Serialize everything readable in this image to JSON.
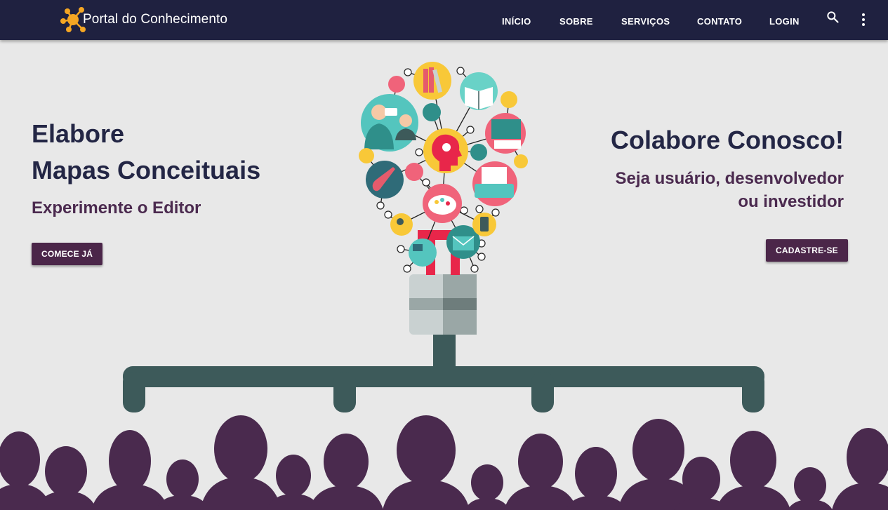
{
  "header": {
    "brand": "Portal do Conhecimento",
    "nav": [
      "INÍCIO",
      "SOBRE",
      "SERVIÇOS",
      "CONTATO",
      "LOGIN"
    ],
    "search_icon": "search-icon",
    "more_icon": "more-vert-icon"
  },
  "hero_left": {
    "title_line1": "Elabore",
    "title_line2": "Mapas Conceituais",
    "subtitle": "Experimente o Editor",
    "button": "COMECE JÁ"
  },
  "hero_right": {
    "title": "Colabore Conosco!",
    "subtitle_line1": "Seja usuário, desenvolvedor",
    "subtitle_line2": "ou investidor",
    "button": "CADASTRE-SE"
  },
  "colors": {
    "header_bg": "#1f2140",
    "accent": "#4b2649",
    "page_bg": "#e8e8e8",
    "crowd": "#4a2a4e",
    "branch": "#3d5a5a",
    "logo": "#f5a623"
  }
}
